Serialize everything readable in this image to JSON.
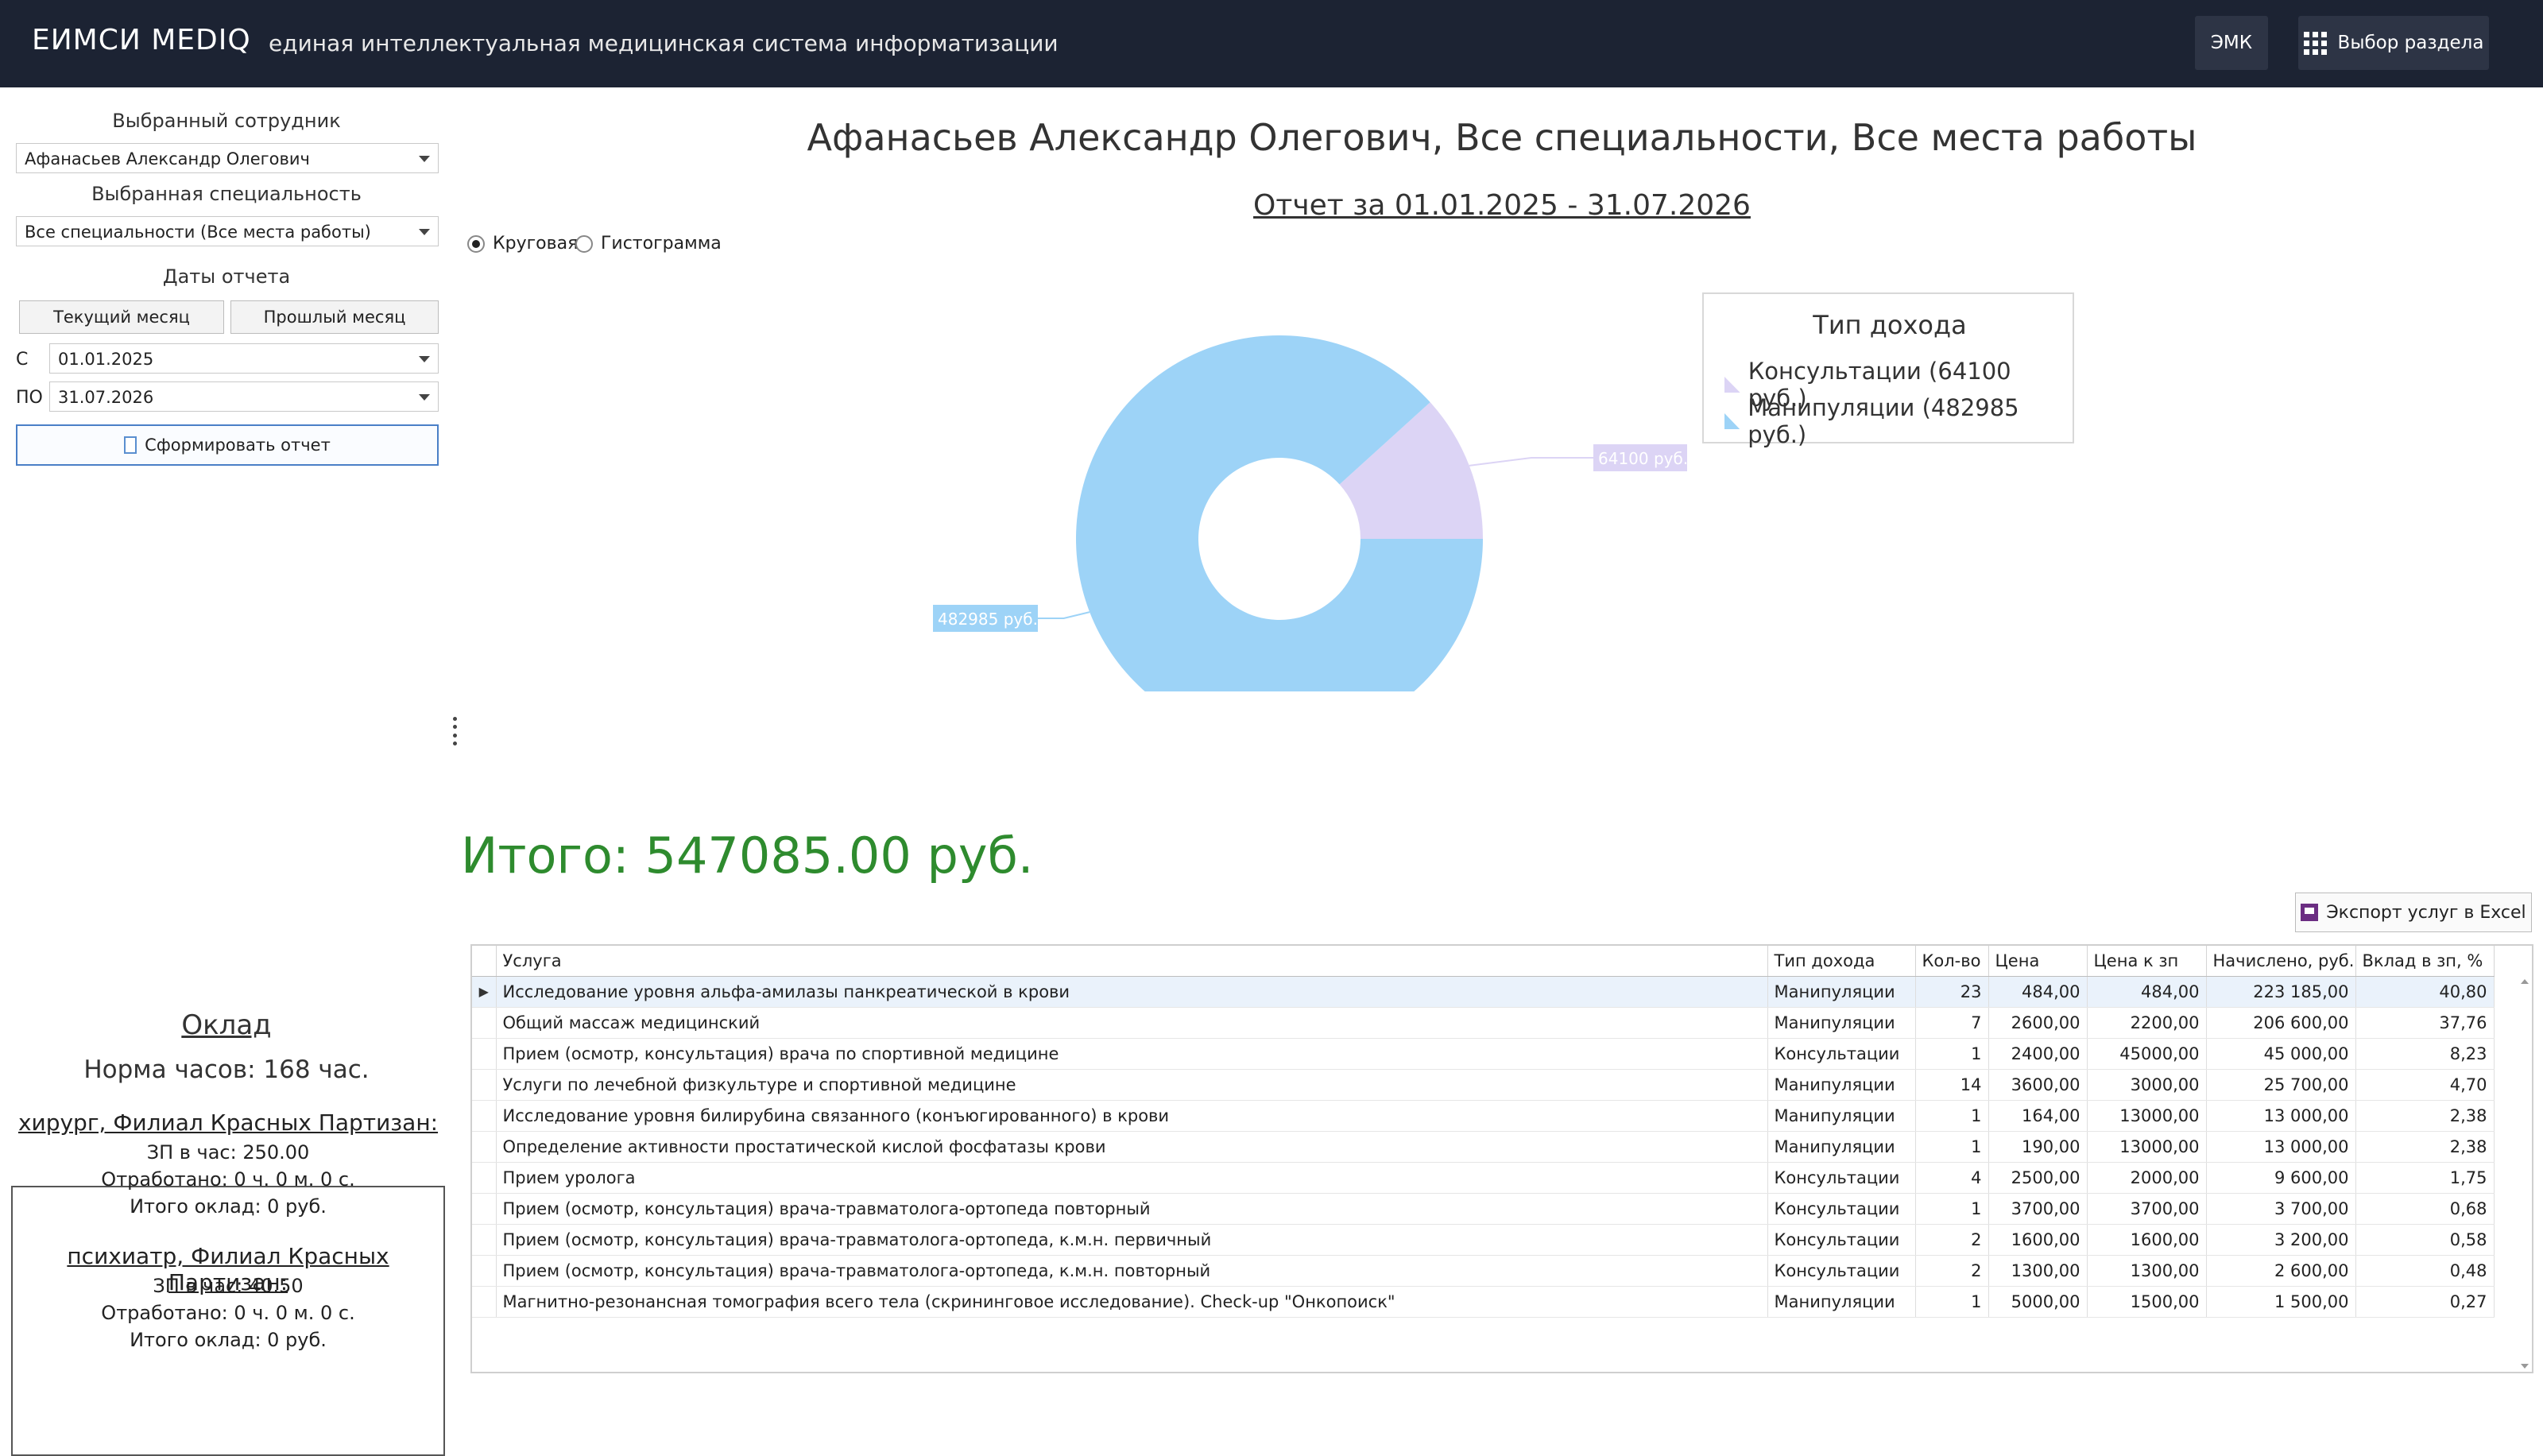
{
  "header": {
    "brand": "ЕИМСИ MEDIQ",
    "subtitle": "единая интеллектуальная медицинская система информатизации",
    "emk_label": "ЭМК",
    "section_label": "Выбор раздела"
  },
  "left": {
    "employee_label": "Выбранный сотрудник",
    "employee_value": "Афанасьев Александр Олегович",
    "specialty_label": "Выбранная специальность",
    "specialty_value": "Все специальности (Все места работы)",
    "dates_label": "Даты отчета",
    "current_month": "Текущий месяц",
    "last_month": "Прошлый месяц",
    "from_label": "С",
    "from_value": "01.01.2025",
    "to_label": "ПО",
    "to_value": "31.07.2026",
    "generate_label": "Сформировать отчет"
  },
  "salary": {
    "title": "Оклад",
    "norm": "Норма часов: 168 час.",
    "entries": [
      {
        "place": "хирург, Филиал Красных Партизан:",
        "rate": "ЗП в час: 250.00",
        "worked": "Отработано: 0 ч. 0 м. 0 с.",
        "total": "Итого оклад: 0 руб."
      },
      {
        "place": "психиатр, Филиал Красных Партизан:",
        "rate": "ЗП в час: 40.50",
        "worked": "Отработано: 0 ч. 0 м. 0 с.",
        "total": "Итого оклад: 0 руб."
      }
    ]
  },
  "report": {
    "title": "Афанасьев Александр Олегович, Все специальности, Все места работы",
    "period": "Отчет за 01.01.2025 - 31.07.2026",
    "radio_pie": "Круговая",
    "radio_hist": "Гистограмма",
    "selected": "pie",
    "total": "Итого: 547085.00 руб.",
    "export_label": "Экспорт услуг в Excel"
  },
  "chart_data": {
    "type": "pie",
    "donut": true,
    "legend_title": "Тип дохода",
    "legend_position": "top-right",
    "slices": [
      {
        "label": "Консультации (64100 руб.)",
        "value": 64100,
        "data_label": "64100 руб.",
        "color": "#dcd4f5"
      },
      {
        "label": "Манипуляции (482985 руб.)",
        "value": 482985,
        "data_label": "482985 руб.",
        "color": "#9dd3f7"
      }
    ]
  },
  "table": {
    "columns": [
      "Услуга",
      "Тип дохода",
      "Кол-во",
      "Цена",
      "Цена к зп",
      "Начислено, руб.",
      "Вклад в зп, %"
    ],
    "rows": [
      [
        "Исследование уровня альфа-амилазы панкреатической в крови",
        "Манипуляции",
        "23",
        "484,00",
        "484,00",
        "223 185,00",
        "40,80"
      ],
      [
        "Общий массаж медицинский",
        "Манипуляции",
        "7",
        "2600,00",
        "2200,00",
        "206 600,00",
        "37,76"
      ],
      [
        "Прием (осмотр, консультация) врача по спортивной медицине",
        "Консультации",
        "1",
        "2400,00",
        "45000,00",
        "45 000,00",
        "8,23"
      ],
      [
        "Услуги по лечебной физкультуре и спортивной медицине",
        "Манипуляции",
        "14",
        "3600,00",
        "3000,00",
        "25 700,00",
        "4,70"
      ],
      [
        "Исследование уровня билирубина связанного (конъюгированного) в крови",
        "Манипуляции",
        "1",
        "164,00",
        "13000,00",
        "13 000,00",
        "2,38"
      ],
      [
        "Определение активности простатической кислой фосфатазы крови",
        "Манипуляции",
        "1",
        "190,00",
        "13000,00",
        "13 000,00",
        "2,38"
      ],
      [
        "Прием уролога",
        "Консультации",
        "4",
        "2500,00",
        "2000,00",
        "9 600,00",
        "1,75"
      ],
      [
        "Прием (осмотр, консультация) врача-травматолога-ортопеда повторный",
        "Консультации",
        "1",
        "3700,00",
        "3700,00",
        "3 700,00",
        "0,68"
      ],
      [
        "Прием (осмотр, консультация) врача-травматолога-ортопеда, к.м.н. первичный",
        "Консультации",
        "2",
        "1600,00",
        "1600,00",
        "3 200,00",
        "0,58"
      ],
      [
        "Прием (осмотр, консультация) врача-травматолога-ортопеда, к.м.н. повторный",
        "Консультации",
        "2",
        "1300,00",
        "1300,00",
        "2 600,00",
        "0,48"
      ],
      [
        "Магнитно-резонансная томография всего тела (скрининговое исследование). Check-up \"Онкопоиск\"",
        "Манипуляции",
        "1",
        "5000,00",
        "1500,00",
        "1 500,00",
        "0,27"
      ]
    ]
  }
}
